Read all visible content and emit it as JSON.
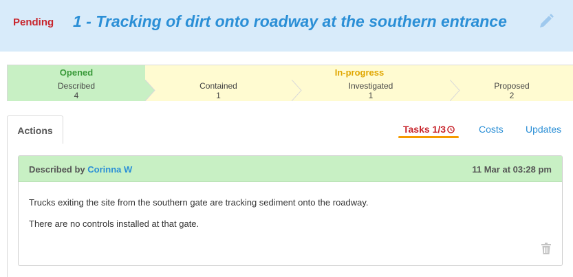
{
  "header": {
    "status": "Pending",
    "title": "1 - Tracking of dirt onto roadway at the southern entrance",
    "edit_icon": "pencil-icon"
  },
  "workflow": {
    "phases": [
      {
        "label": "Opened"
      },
      {
        "label": "In-progress"
      }
    ],
    "steps": [
      {
        "label": "Described",
        "count": "4"
      },
      {
        "label": "Contained",
        "count": "1"
      },
      {
        "label": "Investigated",
        "count": "1"
      },
      {
        "label": "Proposed",
        "count": "2"
      }
    ]
  },
  "tabs": {
    "actions": "Actions",
    "tasks": "Tasks 1/3",
    "tasks_icon": "clock-icon",
    "costs": "Costs",
    "updates": "Updates"
  },
  "entry": {
    "described_by_label": "Described by",
    "author": "Corinna W",
    "timestamp": "11 Mar at 03:28 pm",
    "paragraphs": [
      "Trucks exiting the site from the southern gate are tracking sediment onto the roadway.",
      "There are no controls installed at that gate."
    ],
    "delete_icon": "trash-icon"
  },
  "colors": {
    "pending": "#c8252c",
    "title": "#2b8fd6",
    "opened_bg": "#c8f0c4",
    "inprogress_bg": "#fffbd1",
    "tasks_underline": "#f59b00"
  }
}
